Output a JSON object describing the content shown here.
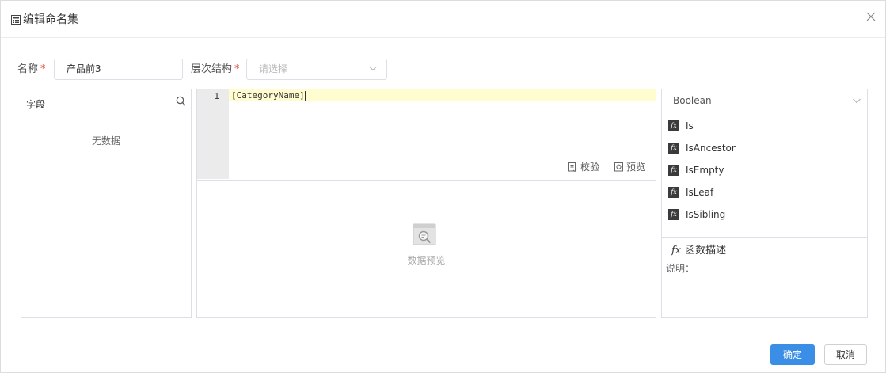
{
  "dialog": {
    "title": "编辑命名集",
    "title_icon": "calculator-icon",
    "close_icon": "close-icon"
  },
  "form": {
    "name_label": "名称",
    "required_mark": "*",
    "name_value": "产品前3",
    "hierarchy_label": "层次结构",
    "hierarchy_placeholder": "请选择"
  },
  "fields_panel": {
    "title": "字段",
    "empty_text": "无数据"
  },
  "editor": {
    "line_number": "1",
    "code": "[CategoryName]",
    "validate_label": "校验",
    "preview_label": "预览",
    "preview_placeholder": "数据预览"
  },
  "functions_panel": {
    "category": "Boolean",
    "functions": [
      "Is",
      "IsAncestor",
      "IsEmpty",
      "IsLeaf",
      "IsSibling"
    ],
    "fx_symbol": "fx",
    "description_title": "函数描述",
    "description_label": "说明："
  },
  "footer": {
    "confirm_label": "确定",
    "cancel_label": "取消"
  },
  "colors": {
    "primary": "#3b8ee5",
    "required": "#e74c3c",
    "border": "#dcdfe6",
    "editor_highlight": "#fffdd0",
    "gutter": "#ebebeb"
  }
}
